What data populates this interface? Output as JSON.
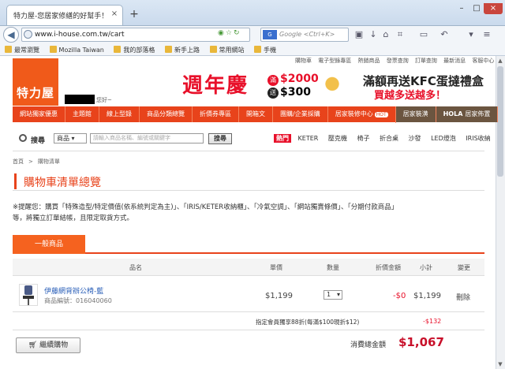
{
  "browser": {
    "tab_title": "特力屋-您居家修繕的好幫手！",
    "url": "www.i-house.com.tw/cart",
    "search_placeholder": "Google <Ctrl+K>",
    "search_engine": "G",
    "bookmarks": [
      "最常瀏覽",
      "Mozilla Taiwan",
      "我的部落格",
      "新手上路",
      "常用網站",
      "手機"
    ]
  },
  "site": {
    "logo": "特力屋",
    "greeting": "您好~",
    "top_links": [
      "購物車",
      "電子型錄專區",
      "熱銷商品",
      "發票查詢",
      "訂單查詢",
      "最新消息",
      "客服中心"
    ]
  },
  "banner": {
    "title": "週年慶",
    "tag1": "滿",
    "amount1": "$2000",
    "tag2": "送",
    "amount2": "$300",
    "right_line1": "滿額再送KFC蛋撻禮盒",
    "right_line2": "買越多送越多！"
  },
  "nav": {
    "items": [
      "網站獨家優惠",
      "主題館",
      "線上型錄",
      "商品分類總覽",
      "折價券專區",
      "開箱文",
      "團購/企業採購",
      "居家裝修中心"
    ],
    "hot_badge": "HOT",
    "extra1": "居家裝潢",
    "extra2": "居家佈置",
    "extra2_brand": "HOLA"
  },
  "search": {
    "label": "搜尋",
    "category": "商品",
    "placeholder": "請輸入商品名稱、編號或關鍵字",
    "button": "搜尋",
    "hot_label": "熱門",
    "hot_terms": [
      "KETER",
      "壓克機",
      "椅子",
      "折合桌",
      "沙發",
      "LED燈泡",
      "IRIS收納"
    ]
  },
  "breadcrumb": {
    "home": "首頁",
    "sep": ">",
    "current": "購物清單"
  },
  "page": {
    "title": "購物車清單總覽",
    "notice_line1": "※提醒您：購買「特殊造型/特定價值(依系統判定為主)」、「IRIS/KETER收納櫃」、「冷氣空調」、「網站獨賣條價」、「分期付款商品」",
    "notice_line2": "等，將獨立訂單結帳，且限定取貨方式。"
  },
  "cart": {
    "tab_label": "一般商品",
    "headers": {
      "name": "品名",
      "price": "單價",
      "qty": "數量",
      "discount": "折價金額",
      "subtotal": "小計",
      "change": "變更"
    },
    "items": [
      {
        "name": "伊藤網背辦公椅-藍",
        "sku": "商品編號：016040060",
        "price": "$1,199",
        "qty": "1",
        "discount": "-$0",
        "subtotal": "$1,199",
        "action": "刪除"
      }
    ],
    "member_discount_label": "指定會員獨享88折(每滿$100現折$12)",
    "member_discount_value": "-$132",
    "continue_button": "繼續購物",
    "total_label": "消費總金額",
    "total_value": "$1,067"
  }
}
